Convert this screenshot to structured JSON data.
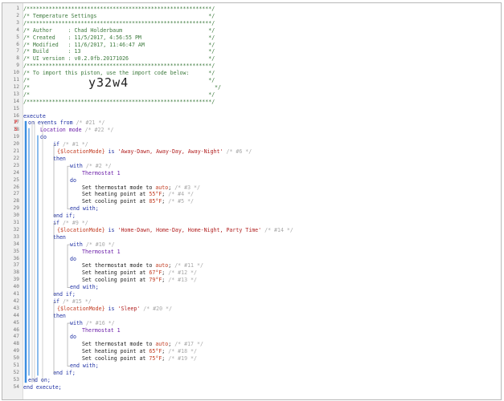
{
  "editor": {
    "line_numbers": [
      "1",
      "2",
      "3",
      "4",
      "5",
      "6",
      "7",
      "8",
      "9",
      "10",
      "11",
      "12",
      "13",
      "14",
      "15",
      "16",
      "17",
      "18",
      "19",
      "20",
      "21",
      "22",
      "23",
      "24",
      "25",
      "26",
      "27",
      "28",
      "29",
      "30",
      "31",
      "32",
      "33",
      "34",
      "35",
      "36",
      "37",
      "38",
      "39",
      "40",
      "41",
      "42",
      "43",
      "44",
      "45",
      "46",
      "47",
      "48",
      "49",
      "50",
      "51",
      "52",
      "53",
      "54"
    ],
    "markers": {
      "17": "P",
      "18": "S"
    },
    "header": {
      "line1": "/**********************************************************/",
      "line2": "/* Temperature Settings                                   */",
      "line3": "/**********************************************************/",
      "line4": "/* Author     : Chad Holderbaum                           */",
      "line5": "/* Created    : 11/5/2017, 4:56:55 PM                     */",
      "line6": "/* Modified   : 11/6/2017, 11:46:47 AM                    */",
      "line7": "/* Build      : 13                                        */",
      "line8": "/* UI version : v0.2.0fb.20171026                         */",
      "line9": "/**********************************************************/",
      "line10": "/* To import this piston, use the import code below:      */",
      "line11": "/*                                                        */",
      "line12_start": "/*",
      "line12_end": "*/",
      "import_code": "y32w4",
      "line13": "/*                                                        */",
      "line14": "/**********************************************************/"
    },
    "code": {
      "execute": "execute",
      "on_events_from": "on events from",
      "c21": "/* #21 */",
      "location_mode": "Location mode",
      "c22": "/* #22 */",
      "do": "do",
      "if": "if",
      "then": "then",
      "with": "with",
      "end_with": "end with;",
      "end_if": "end if;",
      "end_on": "end on;",
      "end_execute": "end execute;",
      "is": "is",
      "location_var": "{$locationMode}",
      "thermostat": "Thermostat 1",
      "set_mode": "Set thermostat mode to",
      "set_heat": "Set heating point at",
      "set_cool": "Set cooling point at",
      "auto": "auto",
      "degF": "°F",
      "semicolon": ";",
      "block1": {
        "c_if": "/* #1 */",
        "cond": "'Away-Dawn, Away-Day, Away-Night'",
        "c_cond": "/* #6 */",
        "c_with": "/* #2 */",
        "c_mode": "/* #3 */",
        "heat": "55",
        "c_heat": "/* #4 */",
        "cool": "85",
        "c_cool": "/* #5 */"
      },
      "block2": {
        "c_if": "/* #9 */",
        "cond": "'Home-Dawn, Home-Day, Home-Night, Party Time'",
        "c_cond": "/* #14 */",
        "c_with": "/* #10 */",
        "c_mode": "/* #11 */",
        "heat": "67",
        "c_heat": "/* #12 */",
        "cool": "79",
        "c_cool": "/* #13 */"
      },
      "block3": {
        "c_if": "/* #15 */",
        "cond": "'Sleep'",
        "c_cond": "/* #20 */",
        "c_with": "/* #16 */",
        "c_mode": "/* #17 */",
        "heat": "65",
        "c_heat": "/* #18 */",
        "cool": "75",
        "c_cool": "/* #19 */"
      }
    },
    "colors": {
      "comment": "#3d7a3d",
      "keyword": "#1d2fa3",
      "variable": "#c23a1f",
      "string": "#b11f1f",
      "hint": "#a8a8a8",
      "device": "#6b1fa8",
      "guide_blue": "#3c8ee0",
      "guide_gray": "#b0b0b0"
    }
  }
}
